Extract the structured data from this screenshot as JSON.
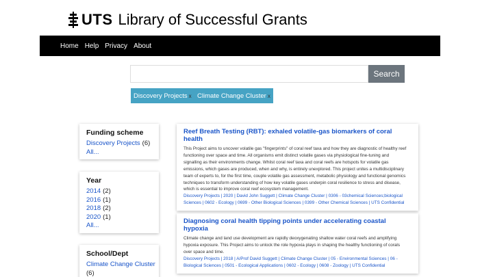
{
  "header": {
    "logo_text": "UTS",
    "site_title": "Library of Successful Grants"
  },
  "nav": [
    "Home",
    "Help",
    "Privacy",
    "About"
  ],
  "search": {
    "value": "",
    "placeholder": "",
    "button_label": "Search"
  },
  "active_filters": [
    {
      "label": "Discovery Projects",
      "remove": "x"
    },
    {
      "label": "Climate Change Cluster",
      "remove": "x"
    }
  ],
  "facets": {
    "funding": {
      "title": "Funding scheme",
      "items": [
        {
          "label": "Discovery Projects",
          "count": "(6)"
        }
      ],
      "all_label": "All..."
    },
    "year": {
      "title": "Year",
      "items": [
        {
          "label": "2014",
          "count": "(2)"
        },
        {
          "label": "2016",
          "count": "(1)"
        },
        {
          "label": "2018",
          "count": "(2)"
        },
        {
          "label": "2020",
          "count": "(1)"
        }
      ],
      "all_label": "All..."
    },
    "school": {
      "title": "School/Dept",
      "items": [
        {
          "label": "Climate Change Cluster",
          "count": "(6)"
        }
      ]
    }
  },
  "results": [
    {
      "title": "Reef Breath Testing (RBT): exhaled volatile-gas biomarkers of coral health",
      "description_lines": [
        "This Project aims to uncover volatile gas \"fingerprints\" of coral reef taxa and how they are diagnostic of healthy reef",
        "functioning over space and time. All organisms emit distinct volatile gases via physiological fine-tuning and",
        "signalling as their environments change. Whilst coral reef taxa and coral reefs are hotspots for volatile gas",
        "emissions, which gases are produced, when and why, is entirely unexplored. This project unites a multidisciplinary",
        "team of experts to, for the first time, couple volatile gas assessment, metabolic physiology and functional genomics",
        "techniques to transform understanding of how key volatile gases underpin coral resilience to stress and disease,",
        "which is essential to improve coral reef ecosystem management."
      ],
      "tag_lines": [
        "Discovery Projects | 2020 | David John Suggett | Climate Change Cluster | 0306 - 03chemical Sciences;biological",
        "Sciences | 0602 - Ecology | 0699 - Other Biological Sciences | 0399 - Other Chemical Sciences | UTS Confidential"
      ]
    },
    {
      "title": "Diagnosing coral health tipping points under accelerating coastal hypoxia",
      "description_lines": [
        "Climate change and land use development are rapidly deoxygenating shallow water coral reefs and amplifying",
        "hypoxia exposure. This Project aims to unlock the role hypoxia plays in shaping the healthy functioning of corals",
        "over space and time."
      ],
      "tag_lines": [
        "Discovery Projects | 2018 | A/Prof David Suggett | Climate Change Cluster | 05 - Environmental Sciences | 06 -",
        "Biological Sciences | 0501 - Ecological Applications | 0602 - Ecology | 0608 - Zoology | UTS Confidential"
      ]
    }
  ]
}
